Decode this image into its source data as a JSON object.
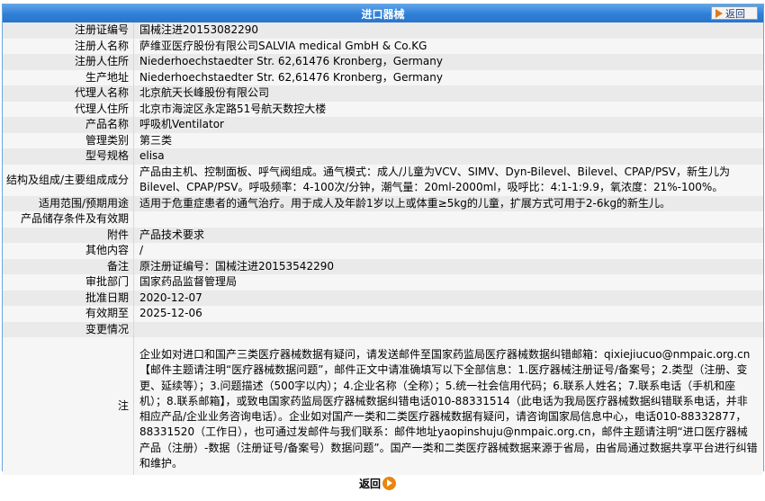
{
  "header": {
    "title": "进口器械",
    "back_label": "返回"
  },
  "rows": [
    {
      "label": "注册证编号",
      "value": "国械注进20153082290"
    },
    {
      "label": "注册人名称",
      "value": "萨维亚医疗股份有限公司SALVIA medical GmbH & Co.KG"
    },
    {
      "label": "注册人住所",
      "value": "Niederhoechstaedter Str. 62,61476 Kronberg，Germany"
    },
    {
      "label": "生产地址",
      "value": "Niederhoechstaedter Str. 62,61476 Kronberg，Germany"
    },
    {
      "label": "代理人名称",
      "value": "北京航天长峰股份有限公司"
    },
    {
      "label": "代理人住所",
      "value": "北京市海淀区永定路51号航天数控大楼"
    },
    {
      "label": "产品名称",
      "value": "呼吸机Ventilator"
    },
    {
      "label": "管理类别",
      "value": "第三类"
    },
    {
      "label": "型号规格",
      "value": "elisa"
    },
    {
      "label": "结构及组成/主要组成成分",
      "value": "产品由主机、控制面板、呼气阀组成。通气模式：成人/儿童为VCV、SIMV、Dyn-Bilevel、Bilevel、CPAP/PSV，新生儿为Bilevel、CPAP/PSV。呼吸频率：4-100次/分钟，潮气量：20ml-2000ml，吸呼比：4:1-1:9.9，氧浓度：21%-100%。"
    },
    {
      "label": "适用范围/预期用途",
      "value": "适用于危重症患者的通气治疗。用于成人及年龄1岁以上或体重≥5kg的儿童，扩展方式可用于2-6kg的新生儿。"
    },
    {
      "label": "产品储存条件及有效期",
      "value": ""
    },
    {
      "label": "附件",
      "value": "产品技术要求"
    },
    {
      "label": "其他内容",
      "value": "/"
    },
    {
      "label": "备注",
      "value": "原注册证编号：国械注进20153542290"
    },
    {
      "label": "审批部门",
      "value": "国家药品监督管理局"
    },
    {
      "label": "批准日期",
      "value": "2020-12-07"
    },
    {
      "label": "有效期至",
      "value": "2025-12-06"
    },
    {
      "label": "变更情况",
      "value": ""
    }
  ],
  "note": {
    "label": "注",
    "text": "企业如对进口和国产三类医疗器械数据有疑问，请发送邮件至国家药监局医疗器械数据纠错邮箱：qixiejiucuo@nmpaic.org.cn【邮件主题请注明“医疗器械数据问题”，邮件正文中请准确填写以下全部信息：1.医疗器械注册证号/备案号；2.类型（注册、变更、延续等）；3.问题描述（500字以内）；4.企业名称（全称）；5.统一社会信用代码；6.联系人姓名；7.联系电话（手机和座机）；8.联系邮箱】，或致电国家药监局医疗器械数据纠错电话010-88331514（此电话为我局医疗器械数据纠错联系电话，并非相应产品/企业业务咨询电话）。企业如对国产一类和二类医疗器械数据有疑问，请咨询国家局信息中心，电话010-88332877，88331520（工作日），也可通过发邮件与我们联系：邮件地址yaopinshuju@nmpaic.org.cn，邮件主题请注明“进口医疗器械产品（注册）-数据（注册证号/备案号）数据问题”。国产一类和二类医疗器械数据来源于省局，由省局通过数据共享平台进行纠错和维护。"
  },
  "footer": {
    "back_label": "返回"
  }
}
